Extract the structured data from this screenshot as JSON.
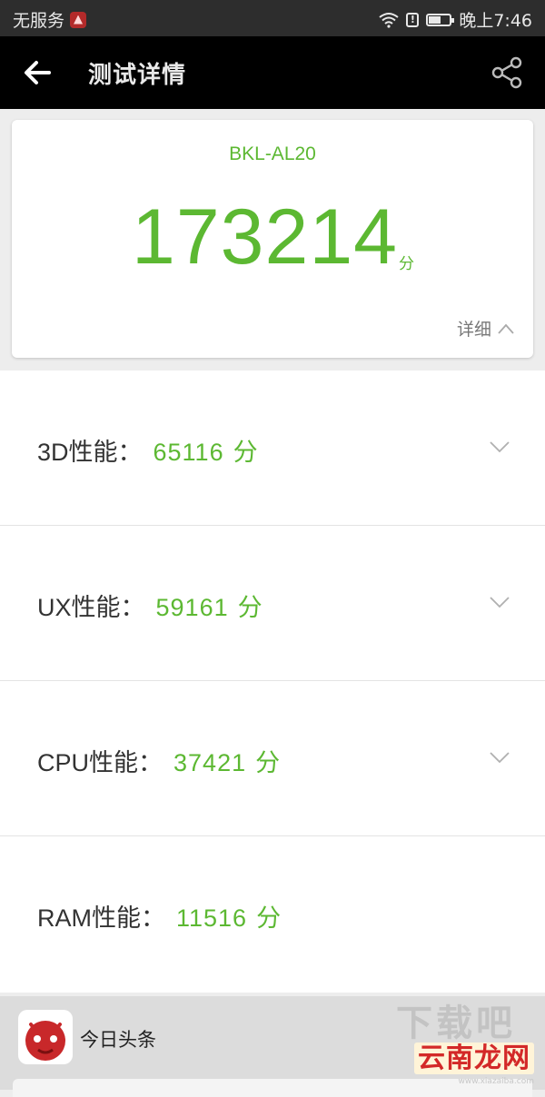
{
  "status_bar": {
    "carrier": "无服务",
    "time": "晚上7:46",
    "battery_level": 0.6,
    "icons": [
      "wifi-icon",
      "alert-icon",
      "battery-icon"
    ]
  },
  "app_bar": {
    "title": "测试详情",
    "back_icon": "arrow-left-icon",
    "share_icon": "share-icon"
  },
  "score_card": {
    "device": "BKL-AL20",
    "total_score": "173214",
    "unit": "分",
    "detail_label": "详细"
  },
  "sub_scores": [
    {
      "name": "3D性能：",
      "value": "65116",
      "unit": "分",
      "expandable": true
    },
    {
      "name": "UX性能：",
      "value": "59161",
      "unit": "分",
      "expandable": true
    },
    {
      "name": "CPU性能：",
      "value": "37421",
      "unit": "分",
      "expandable": true
    },
    {
      "name": "RAM性能：",
      "value": "11516",
      "unit": "分",
      "expandable": false
    }
  ],
  "notification": {
    "app_name": "今日头条",
    "icon": "antutu-icon"
  },
  "watermark": {
    "text": "云南龙网",
    "sub": "www.xiazaiba.com",
    "ghost": "下载吧"
  },
  "colors": {
    "accent_green": "#5cb832",
    "app_bar": "#000000",
    "status_bar": "#2d2d2d"
  }
}
